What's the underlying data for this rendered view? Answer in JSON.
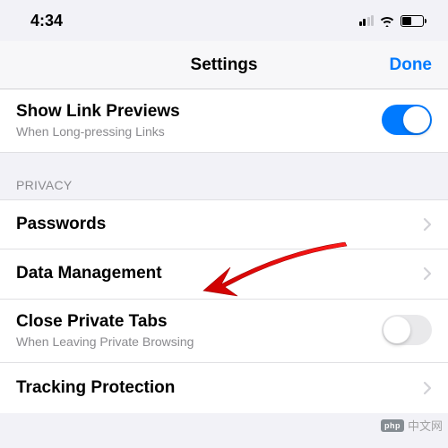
{
  "status": {
    "time": "4:34"
  },
  "nav": {
    "title": "Settings",
    "done": "Done"
  },
  "rows": {
    "linkPreviews": {
      "title": "Show Link Previews",
      "sub": "When Long-pressing Links",
      "on": true
    },
    "privacyHeader": "PRIVACY",
    "passwords": {
      "title": "Passwords"
    },
    "dataManagement": {
      "title": "Data Management"
    },
    "closePrivate": {
      "title": "Close Private Tabs",
      "sub": "When Leaving Private Browsing",
      "on": false
    },
    "trackingProtection": {
      "title": "Tracking Protection"
    }
  },
  "watermark": {
    "logo": "php",
    "text": "中文网"
  }
}
